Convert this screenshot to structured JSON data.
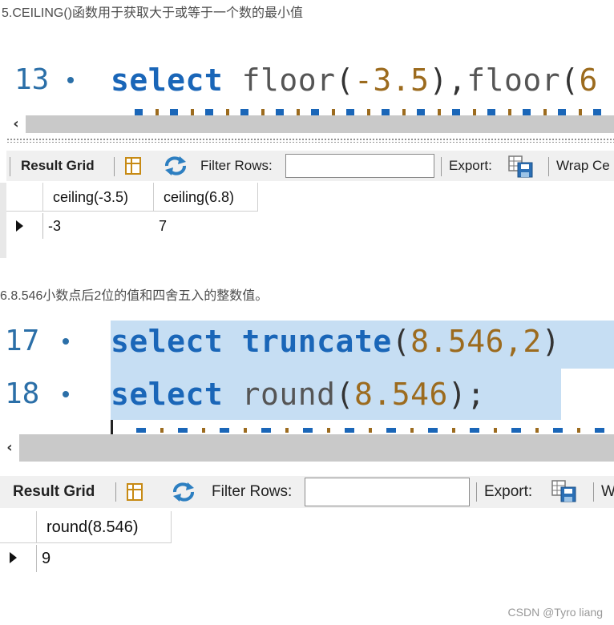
{
  "section5": {
    "heading": "5.CEILING()函数用于获取大于或等于一个数的最小值",
    "editor": {
      "line_number": "13",
      "code_kw": "select",
      "code_rest_fn1": "floor",
      "code_rest_open1": "(",
      "code_rest_num1": "-3.5",
      "code_rest_close1": "),",
      "code_rest_fn2": "floor",
      "code_rest_open2": "(",
      "code_rest_num2": "6"
    },
    "scroll_arrow": "‹",
    "toolbar": {
      "result_grid": "Result Grid",
      "filter_rows": "Filter Rows:",
      "filter_value": "",
      "export": "Export:",
      "wrap": "Wrap Ce"
    },
    "grid": {
      "columns": [
        "ceiling(-3.5)",
        "ceiling(6.8)"
      ],
      "rows": [
        [
          "-3",
          "7"
        ]
      ]
    }
  },
  "section6": {
    "heading": "6.8.546小数点后2位的值和四舍五入的整数值。",
    "editor": {
      "line1_number": "17",
      "line1_kw": "select",
      "line1_fn": "truncate",
      "line1_open": "(",
      "line1_num": "8.546,2",
      "line1_close": ")",
      "line2_number": "18",
      "line2_kw": "select",
      "line2_fn": "round",
      "line2_open": "(",
      "line2_num": "8.546",
      "line2_close": ");"
    },
    "scroll_arrow": "‹",
    "toolbar": {
      "result_grid": "Result Grid",
      "filter_rows": "Filter Rows:",
      "filter_value": "",
      "export": "Export:",
      "wrap": "W"
    },
    "grid": {
      "columns": [
        "round(8.546)"
      ],
      "rows": [
        [
          "9"
        ]
      ]
    }
  },
  "footer": "CSDN @Tyro liang",
  "icons": [
    "result-grid-icon",
    "refresh-icon",
    "export-icon",
    "row-pointer-icon"
  ],
  "colors": {
    "keyword": "#1a66b8",
    "number": "#9c6b1e",
    "line_number": "#2b6fa8",
    "selection": "#c6def3",
    "toolbar_bg": "#f0f0f0"
  }
}
